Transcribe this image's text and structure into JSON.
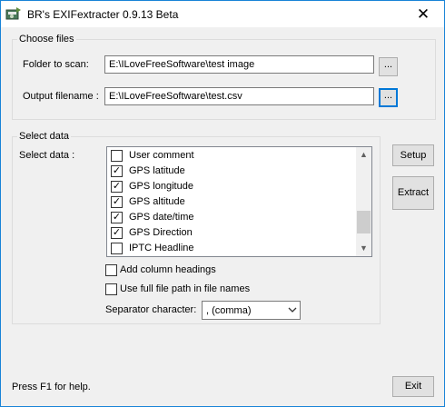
{
  "window": {
    "title": "BR's EXIFextracter 0.9.13 Beta",
    "close_glyph": "✕"
  },
  "choose_files": {
    "group_label": "Choose files",
    "folder_label": "Folder to scan:",
    "folder_value": "E:\\ILoveFreeSoftware\\test image",
    "output_label": "Output filename :",
    "output_value": "E:\\ILoveFreeSoftware\\test.csv",
    "browse_label": "..."
  },
  "select_data": {
    "group_label": "Select data",
    "list_label": "Select data :",
    "items": [
      {
        "label": "User comment",
        "checked": false
      },
      {
        "label": "GPS latitude",
        "checked": true
      },
      {
        "label": "GPS longitude",
        "checked": true
      },
      {
        "label": "GPS altitude",
        "checked": true
      },
      {
        "label": "GPS date/time",
        "checked": true
      },
      {
        "label": "GPS Direction",
        "checked": true
      },
      {
        "label": "IPTC Headline",
        "checked": false
      }
    ],
    "scroll_position": 0.87,
    "add_headings_label": "Add column headings",
    "add_headings_checked": false,
    "full_path_label": "Use full file path in file names",
    "full_path_checked": false,
    "separator_label": "Separator character:",
    "separator_value": ", (comma)"
  },
  "buttons": {
    "setup": "Setup",
    "extract": "Extract",
    "exit": "Exit"
  },
  "status": {
    "help_text": "Press F1 for help."
  },
  "icons": {
    "app": "camera-icon",
    "checkmark": "✓",
    "scroll_up": "▲",
    "scroll_down": "▼",
    "dropdown": "chevron-down-icon"
  },
  "colors": {
    "accent": "#0078d7",
    "window_bg": "#f0f0f0"
  }
}
